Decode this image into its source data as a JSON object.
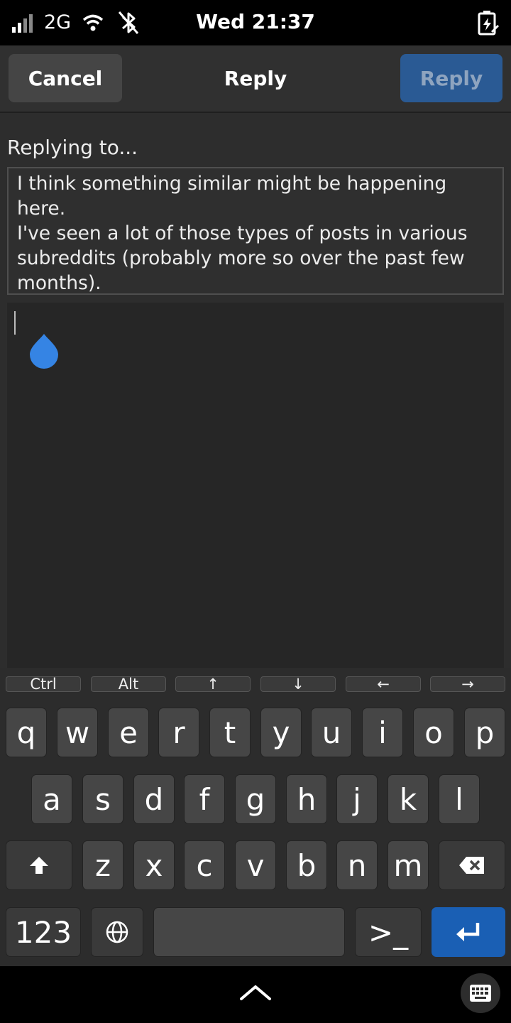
{
  "status": {
    "network": "2G",
    "time": "Wed 21:37"
  },
  "header": {
    "cancel_label": "Cancel",
    "title": "Reply",
    "reply_label": "Reply"
  },
  "content": {
    "replying_label": "Replying to...",
    "quote_lines": [
      "I think something similar might be happening here.",
      "I've seen a lot of those types of posts in various",
      "subreddits (probably more so over the past few",
      "months)."
    ],
    "editor_value": ""
  },
  "keyboard": {
    "modifiers": [
      "Ctrl",
      "Alt",
      "↑",
      "↓",
      "←",
      "→"
    ],
    "row1": [
      "q",
      "w",
      "e",
      "r",
      "t",
      "y",
      "u",
      "i",
      "o",
      "p"
    ],
    "row2": [
      "a",
      "s",
      "d",
      "f",
      "g",
      "h",
      "j",
      "k",
      "l"
    ],
    "row3": [
      "z",
      "x",
      "c",
      "v",
      "b",
      "n",
      "m"
    ],
    "numbers_label": "123",
    "terminal_label": ">_",
    "accent_color": "#1a5fb4"
  }
}
